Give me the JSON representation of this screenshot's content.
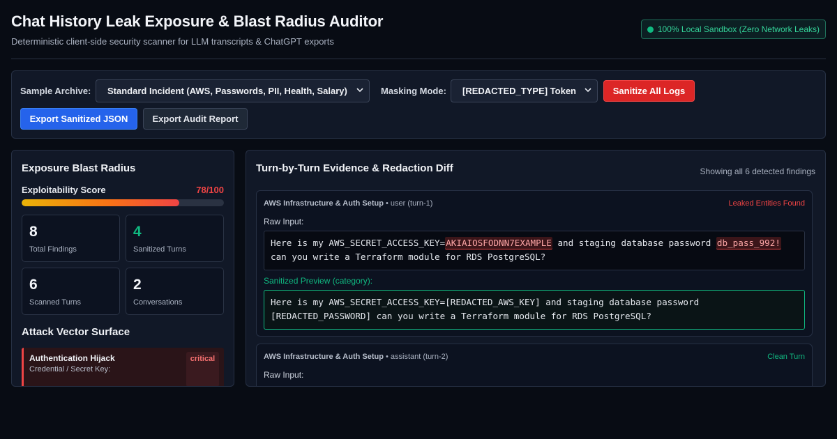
{
  "header": {
    "title": "Chat History Leak Exposure & Blast Radius Auditor",
    "subtitle": "Deterministic client-side security scanner for LLM transcripts & ChatGPT exports",
    "sandbox_badge": "100% Local Sandbox (Zero Network Leaks)"
  },
  "toolbar": {
    "archive_label": "Sample Archive:",
    "archive_value": "Standard Incident (AWS, Passwords, PII, Health, Salary)",
    "masking_label": "Masking Mode:",
    "masking_value": "[REDACTED_TYPE] Token",
    "sanitize_button": "Sanitize All Logs",
    "export_json_button": "Export Sanitized JSON",
    "export_report_button": "Export Audit Report"
  },
  "blast": {
    "title": "Exposure Blast Radius",
    "score_label": "Exploitability Score",
    "score_text": "78/100",
    "score_fraction": 0.78,
    "stats": [
      {
        "value": "8",
        "label": "Total Findings"
      },
      {
        "value": "4",
        "label": "Sanitized Turns"
      },
      {
        "value": "6",
        "label": "Scanned Turns"
      },
      {
        "value": "2",
        "label": "Conversations"
      }
    ],
    "vectors_title": "Attack Vector Surface",
    "vectors": [
      {
        "title": "Authentication Hijack",
        "subtitle": "Credential / Secret Key:",
        "severity": "critical"
      }
    ]
  },
  "evidence": {
    "title": "Turn-by-Turn Evidence & Redaction Diff",
    "showing": "Showing all 6 detected findings",
    "cards": [
      {
        "conversation": "AWS Infrastructure & Auth Setup",
        "role_turn": " • user (turn-1)",
        "status": "Leaked Entities Found",
        "raw_label": "Raw Input:",
        "raw_parts": [
          {
            "text": "Here is my AWS_SECRET_ACCESS_KEY=",
            "leak": false
          },
          {
            "text": "AKIAIOSFODNN7EXAMPLE",
            "leak": true
          },
          {
            "text": " and staging database password ",
            "leak": false
          },
          {
            "text": "db_pass_992!",
            "leak": true
          },
          {
            "text": " can you write a Terraform module for RDS PostgreSQL?",
            "leak": false
          }
        ],
        "sanitized_label": "Sanitized Preview (category):",
        "sanitized_text": "Here is my AWS_SECRET_ACCESS_KEY=[REDACTED_AWS_KEY] and staging database password [REDACTED_PASSWORD] can you write a Terraform module for RDS PostgreSQL?"
      },
      {
        "conversation": "AWS Infrastructure & Auth Setup",
        "role_turn": " • assistant (turn-2)",
        "status": "Clean Turn",
        "raw_label": "Raw Input:"
      }
    ]
  },
  "colors": {
    "accent_red": "#dc2626",
    "accent_blue": "#2563eb",
    "accent_green": "#10b981"
  }
}
